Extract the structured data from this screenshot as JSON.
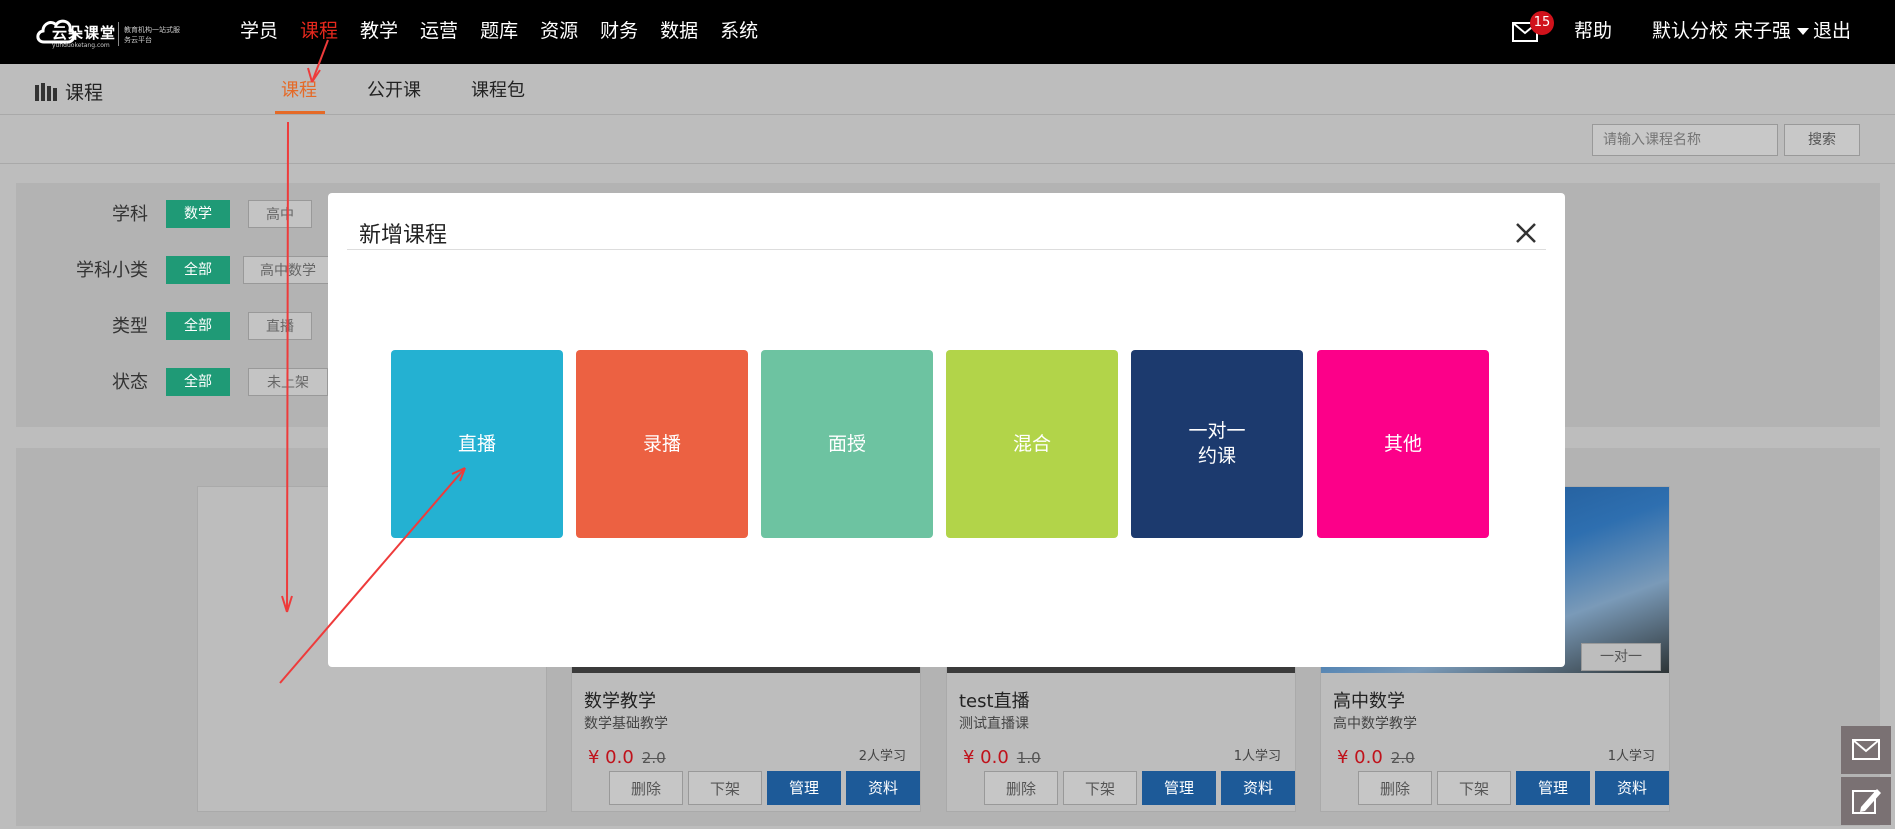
{
  "topnav": {
    "logo": {
      "brand": "云朵课堂",
      "domain": "yunduoketang.com",
      "slogan": "教育机构一站式服务云平台"
    },
    "items": [
      "学员",
      "课程",
      "教学",
      "运营",
      "题库",
      "资源",
      "财务",
      "数据",
      "系统"
    ],
    "active_index": 1,
    "mail_count": "15",
    "help": "帮助",
    "branch": "默认分校",
    "user": "宋子强",
    "logout": "退出"
  },
  "subheader": {
    "title": "课程",
    "tabs": [
      "课程",
      "公开课",
      "课程包"
    ],
    "active_tab": 0
  },
  "search": {
    "placeholder": "请输入课程名称",
    "button": "搜索"
  },
  "filters": {
    "subject": {
      "label": "学科",
      "chips": [
        "数学",
        "高中"
      ]
    },
    "subcategory": {
      "label": "学科小类",
      "chips": [
        "全部",
        "高中数学"
      ]
    },
    "type": {
      "label": "类型",
      "chips": [
        "全部",
        "直播"
      ]
    },
    "status": {
      "label": "状态",
      "chips": [
        "全部",
        "未上架"
      ]
    }
  },
  "courses": [
    {
      "title": "数学教学",
      "desc": "数学基础教学",
      "price": "¥ 0.0",
      "old_price": "2.0",
      "learners": "2人学习",
      "tag": ""
    },
    {
      "title": "test直播",
      "desc": "测试直播课",
      "price": "¥ 0.0",
      "old_price": "1.0",
      "learners": "1人学习",
      "tag": ""
    },
    {
      "title": "高中数学",
      "desc": "高中数学教学",
      "price": "¥ 0.0",
      "old_price": "2.0",
      "learners": "1人学习",
      "tag": "一对一"
    }
  ],
  "course_buttons": {
    "delete": "删除",
    "unpublish": "下架",
    "manage": "管理",
    "materials": "资料"
  },
  "modal": {
    "title": "新增课程",
    "tiles": [
      {
        "label": "直播",
        "color": "#24b1d2"
      },
      {
        "label": "录播",
        "color": "#ec6142"
      },
      {
        "label": "面授",
        "color": "#6dc3a1"
      },
      {
        "label": "混合",
        "color": "#b2d449"
      },
      {
        "label": "一对一\n约课",
        "color": "#1c3a6e"
      },
      {
        "label": "其他",
        "color": "#fc0089"
      }
    ]
  },
  "colors": {
    "nav_active": "#e5281d",
    "tab_active": "#e56a27",
    "chip_on": "#1f9a76",
    "primary_button": "#1d5a98",
    "price": "#c0121b",
    "annotation_arrow": "#ee3b3b"
  }
}
